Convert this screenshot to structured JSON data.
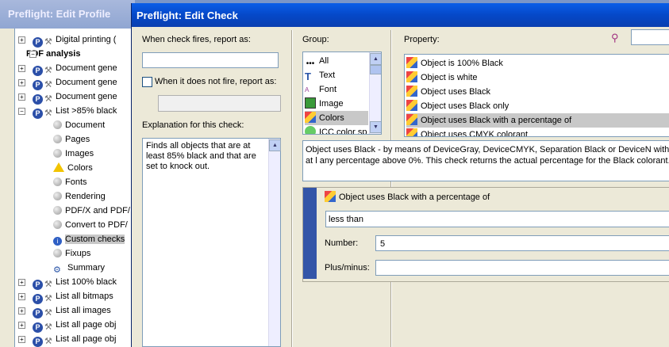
{
  "background_window": {
    "title": "Preflight: Edit Profile",
    "tree": [
      {
        "label": "Digital printing (",
        "icon": "profile"
      },
      {
        "label": "PDF analysis",
        "icon": "none",
        "bold": true
      },
      {
        "label": "Document gene",
        "icon": "profile"
      },
      {
        "label": "Document gene",
        "icon": "profile"
      },
      {
        "label": "Document gene",
        "icon": "profile"
      },
      {
        "label": "List >85% black",
        "icon": "profile"
      },
      {
        "label": "Document",
        "icon": "gray"
      },
      {
        "label": "Pages",
        "icon": "gray"
      },
      {
        "label": "Images",
        "icon": "gray"
      },
      {
        "label": "Colors",
        "icon": "warning"
      },
      {
        "label": "Fonts",
        "icon": "gray"
      },
      {
        "label": "Rendering",
        "icon": "gray"
      },
      {
        "label": "PDF/X and PDF/",
        "icon": "gray"
      },
      {
        "label": "Convert to PDF/",
        "icon": "gray"
      },
      {
        "label": "Custom checks",
        "icon": "info"
      },
      {
        "label": "Fixups",
        "icon": "gray"
      },
      {
        "label": "Summary",
        "icon": "summary"
      },
      {
        "label": "List 100% black",
        "icon": "profile"
      },
      {
        "label": "List all bitmaps",
        "icon": "profile"
      },
      {
        "label": "List all images",
        "icon": "profile"
      },
      {
        "label": "List all page obj",
        "icon": "profile"
      },
      {
        "label": "List all page obj",
        "icon": "profile"
      }
    ]
  },
  "dialog": {
    "title": "Preflight: Edit Check",
    "report_label": "When check fires, report as:",
    "report_value": "",
    "not_fire_label": "When it does not fire, report as:",
    "not_fire_value": "",
    "explanation_label": "Explanation for this check:",
    "explanation_text": "Finds all objects that are at least 85% black and that are set to knock out.",
    "group_label": "Group:",
    "groups": [
      "All",
      "Text",
      "Font",
      "Image",
      "Colors",
      "ICC color sp"
    ],
    "group_selected": "Colors",
    "property_label": "Property:",
    "search_value": "",
    "properties": [
      "Object is 100% Black",
      "Object is white",
      "Object uses Black",
      "Object uses Black only",
      "Object uses Black with a percentage of",
      "Object uses CMYK colorant"
    ],
    "property_selected": "Object uses Black with a percentage of",
    "description": "Object uses Black - by means of DeviceGray, DeviceCMYK, Separation Black or DeviceN with at l any percentage above 0%. This check returns the actual percentage for the Black colorant.",
    "condition": {
      "title": "Object uses Black with a percentage of",
      "operator": "less than",
      "number_label": "Number:",
      "number_value": "5",
      "plusminus_label": "Plus/minus:",
      "plusminus_value": ""
    }
  },
  "colors": {
    "title_bar": "#0548c8",
    "accent_band": "#3355a8",
    "selection": "#c8c8c8"
  }
}
